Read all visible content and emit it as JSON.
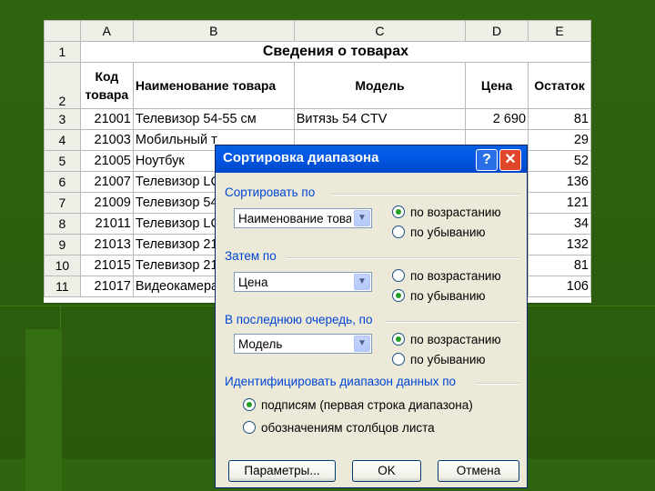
{
  "sheet": {
    "columns": [
      "A",
      "B",
      "C",
      "D",
      "E"
    ],
    "row_numbers": [
      "1",
      "2",
      "3",
      "4",
      "5",
      "6",
      "7",
      "8",
      "9",
      "10",
      "11"
    ],
    "title": "Сведения о товарах",
    "headers": {
      "code_line1": "Код",
      "code_line2": "товара",
      "name": "Наименование товара",
      "model": "Модель",
      "price": "Цена",
      "stock": "Остаток"
    },
    "rows": [
      {
        "code": "21001",
        "name": "Телевизор 54-55 см",
        "model": "Витязь 54 CTV",
        "price": "2 690",
        "stock": "81"
      },
      {
        "code": "21003",
        "name": "Мобильный т",
        "model": "",
        "price": "",
        "stock": "29"
      },
      {
        "code": "21005",
        "name": "Ноутбук",
        "model": "",
        "price": "",
        "stock": "52"
      },
      {
        "code": "21007",
        "name": "Телевизор LC",
        "model": "",
        "price": "",
        "stock": "136"
      },
      {
        "code": "21009",
        "name": "Телевизор 54",
        "model": "",
        "price": "",
        "stock": "121"
      },
      {
        "code": "21011",
        "name": "Телевизор LC",
        "model": "",
        "price": "",
        "stock": "34"
      },
      {
        "code": "21013",
        "name": "Телевизор 21",
        "model": "",
        "price": "",
        "stock": "132"
      },
      {
        "code": "21015",
        "name": "Телевизор 21",
        "model": "",
        "price": "",
        "stock": "81"
      },
      {
        "code": "21017",
        "name": "Видеокамера",
        "model": "",
        "price": "",
        "stock": "106"
      }
    ]
  },
  "dialog": {
    "title": "Сортировка диапазона",
    "help_label": "?",
    "close_label": "✕",
    "sort_by": {
      "label": "Сортировать по",
      "value": "Наименование това",
      "asc": "по возрастанию",
      "desc": "по убыванию",
      "selected": "asc"
    },
    "then_by": {
      "label": "Затем по",
      "value": "Цена",
      "asc": "по возрастанию",
      "desc": "по убыванию",
      "selected": "desc"
    },
    "last_by": {
      "label": "В последнюю очередь, по",
      "value": "Модель",
      "asc": "по возрастанию",
      "desc": "по убыванию",
      "selected": "asc"
    },
    "identify": {
      "label": "Идентифицировать диапазон данных по",
      "option1": "подписям (первая строка диапазона)",
      "option2": "обозначениям столбцов листа",
      "selected": "option1"
    },
    "buttons": {
      "params": "Параметры...",
      "ok": "OK",
      "cancel": "Отмена"
    },
    "dropdown_arrow": "▼"
  },
  "colors": {
    "background": "#2d5e0e",
    "titlebar": "#0058e6",
    "accent_text": "#0046d5",
    "radio_dot": "#21a121"
  }
}
